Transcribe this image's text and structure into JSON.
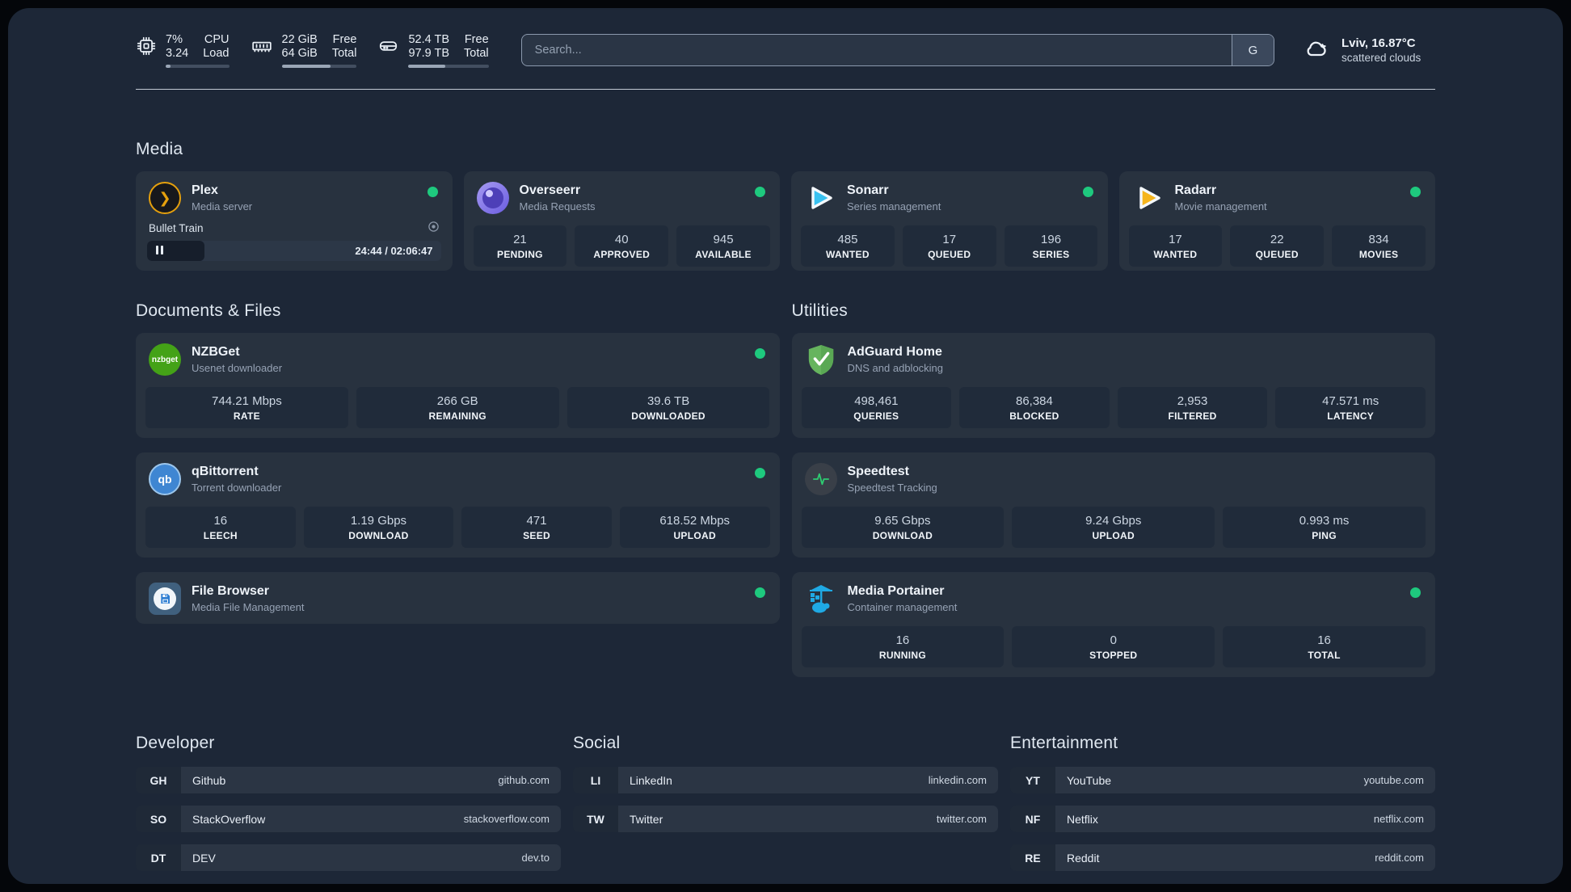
{
  "header": {
    "stats": [
      {
        "icon": "cpu",
        "value_top": "7%",
        "value_bottom": "3.24",
        "label_top": "CPU",
        "label_bottom": "Load",
        "progress": 8
      },
      {
        "icon": "memory",
        "value_top": "22 GiB",
        "value_bottom": "64 GiB",
        "label_top": "Free",
        "label_bottom": "Total",
        "progress": 65
      },
      {
        "icon": "disk",
        "value_top": "52.4 TB",
        "value_bottom": "97.9 TB",
        "label_top": "Free",
        "label_bottom": "Total",
        "progress": 46
      }
    ],
    "search": {
      "placeholder": "Search...",
      "button_label": "G"
    },
    "weather": {
      "location": "Lviv, 16.87°C",
      "condition": "scattered clouds"
    }
  },
  "media": {
    "title": "Media",
    "plex": {
      "name": "Plex",
      "description": "Media server",
      "now_playing": "Bullet Train",
      "time": "24:44 / 02:06:47",
      "progress": 19.5
    },
    "overseerr": {
      "name": "Overseerr",
      "description": "Media Requests",
      "stats": [
        {
          "value": "21",
          "label": "PENDING"
        },
        {
          "value": "40",
          "label": "APPROVED"
        },
        {
          "value": "945",
          "label": "AVAILABLE"
        }
      ]
    },
    "sonarr": {
      "name": "Sonarr",
      "description": "Series management",
      "stats": [
        {
          "value": "485",
          "label": "WANTED"
        },
        {
          "value": "17",
          "label": "QUEUED"
        },
        {
          "value": "196",
          "label": "SERIES"
        }
      ]
    },
    "radarr": {
      "name": "Radarr",
      "description": "Movie management",
      "stats": [
        {
          "value": "17",
          "label": "WANTED"
        },
        {
          "value": "22",
          "label": "QUEUED"
        },
        {
          "value": "834",
          "label": "MOVIES"
        }
      ]
    }
  },
  "documents": {
    "title": "Documents & Files",
    "nzbget": {
      "name": "NZBGet",
      "description": "Usenet downloader",
      "icon_label": "nzbget",
      "stats": [
        {
          "value": "744.21 Mbps",
          "label": "RATE"
        },
        {
          "value": "266 GB",
          "label": "REMAINING"
        },
        {
          "value": "39.6 TB",
          "label": "DOWNLOADED"
        }
      ]
    },
    "qbittorrent": {
      "name": "qBittorrent",
      "description": "Torrent downloader",
      "icon_label": "qb",
      "stats": [
        {
          "value": "16",
          "label": "LEECH"
        },
        {
          "value": "1.19 Gbps",
          "label": "DOWNLOAD"
        },
        {
          "value": "471",
          "label": "SEED"
        },
        {
          "value": "618.52 Mbps",
          "label": "UPLOAD"
        }
      ]
    },
    "filebrowser": {
      "name": "File Browser",
      "description": "Media File Management"
    }
  },
  "utilities": {
    "title": "Utilities",
    "adguard": {
      "name": "AdGuard Home",
      "description": "DNS and adblocking",
      "stats": [
        {
          "value": "498,461",
          "label": "QUERIES"
        },
        {
          "value": "86,384",
          "label": "BLOCKED"
        },
        {
          "value": "2,953",
          "label": "FILTERED"
        },
        {
          "value": "47.571 ms",
          "label": "LATENCY"
        }
      ]
    },
    "speedtest": {
      "name": "Speedtest",
      "description": "Speedtest Tracking",
      "stats": [
        {
          "value": "9.65 Gbps",
          "label": "DOWNLOAD"
        },
        {
          "value": "9.24 Gbps",
          "label": "UPLOAD"
        },
        {
          "value": "0.993 ms",
          "label": "PING"
        }
      ]
    },
    "portainer": {
      "name": "Media Portainer",
      "description": "Container management",
      "stats": [
        {
          "value": "16",
          "label": "RUNNING"
        },
        {
          "value": "0",
          "label": "STOPPED"
        },
        {
          "value": "16",
          "label": "TOTAL"
        }
      ]
    }
  },
  "bookmarks": {
    "developer": {
      "title": "Developer",
      "links": [
        {
          "abbr": "GH",
          "name": "Github",
          "url": "github.com"
        },
        {
          "abbr": "SO",
          "name": "StackOverflow",
          "url": "stackoverflow.com"
        },
        {
          "abbr": "DT",
          "name": "DEV",
          "url": "dev.to"
        }
      ]
    },
    "social": {
      "title": "Social",
      "links": [
        {
          "abbr": "LI",
          "name": "LinkedIn",
          "url": "linkedin.com"
        },
        {
          "abbr": "TW",
          "name": "Twitter",
          "url": "twitter.com"
        }
      ]
    },
    "entertainment": {
      "title": "Entertainment",
      "links": [
        {
          "abbr": "YT",
          "name": "YouTube",
          "url": "youtube.com"
        },
        {
          "abbr": "NF",
          "name": "Netflix",
          "url": "netflix.com"
        },
        {
          "abbr": "RE",
          "name": "Reddit",
          "url": "reddit.com"
        }
      ]
    }
  },
  "colors": {
    "background": "#1d2737",
    "card": "#28323f",
    "accent_green": "#1ec97e",
    "plex_orange": "#e5a00d"
  }
}
